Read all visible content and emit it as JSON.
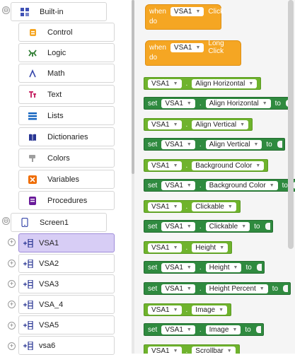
{
  "tree": {
    "builtin": {
      "label": "Built-in",
      "toggle": "⊖"
    },
    "categories": [
      {
        "label": "Control",
        "icon": "control-icon",
        "color": "#f5a623"
      },
      {
        "label": "Logic",
        "icon": "logic-icon",
        "color": "#2e7d32"
      },
      {
        "label": "Math",
        "icon": "math-icon",
        "color": "#3949ab"
      },
      {
        "label": "Text",
        "icon": "text-icon",
        "color": "#c2185b"
      },
      {
        "label": "Lists",
        "icon": "lists-icon",
        "color": "#1565c0"
      },
      {
        "label": "Dictionaries",
        "icon": "dictionaries-icon",
        "color": "#283593"
      },
      {
        "label": "Colors",
        "icon": "colors-icon",
        "color": "#9e9e9e"
      },
      {
        "label": "Variables",
        "icon": "variables-icon",
        "color": "#ef6c00"
      },
      {
        "label": "Procedures",
        "icon": "procedures-icon",
        "color": "#6a1b9a"
      }
    ],
    "screen": {
      "label": "Screen1",
      "toggle": "⊖"
    },
    "components": [
      {
        "label": "VSA1",
        "selected": true
      },
      {
        "label": "VSA2",
        "selected": false
      },
      {
        "label": "VSA3",
        "selected": false
      },
      {
        "label": "VSA_4",
        "selected": false
      },
      {
        "label": "VSA5",
        "selected": false
      },
      {
        "label": "vsa6",
        "selected": false
      }
    ]
  },
  "blocks": {
    "event_click": {
      "when": "when",
      "component": "VSA1",
      "event": "Click",
      "do": "do"
    },
    "event_longclick": {
      "when": "when",
      "component": "VSA1",
      "event": "Long Click",
      "do": "do"
    },
    "list": [
      {
        "type": "getter",
        "component": "VSA1",
        "property": "Align Horizontal"
      },
      {
        "type": "setter",
        "set": "set",
        "component": "VSA1",
        "property": "Align Horizontal",
        "to": "to"
      },
      {
        "type": "getter",
        "component": "VSA1",
        "property": "Align Vertical"
      },
      {
        "type": "setter",
        "set": "set",
        "component": "VSA1",
        "property": "Align Vertical",
        "to": "to"
      },
      {
        "type": "getter",
        "component": "VSA1",
        "property": "Background Color"
      },
      {
        "type": "setter",
        "set": "set",
        "component": "VSA1",
        "property": "Background Color",
        "to": "to"
      },
      {
        "type": "getter",
        "component": "VSA1",
        "property": "Clickable"
      },
      {
        "type": "setter",
        "set": "set",
        "component": "VSA1",
        "property": "Clickable",
        "to": "to"
      },
      {
        "type": "getter",
        "component": "VSA1",
        "property": "Height"
      },
      {
        "type": "setter",
        "set": "set",
        "component": "VSA1",
        "property": "Height",
        "to": "to"
      },
      {
        "type": "setter",
        "set": "set",
        "component": "VSA1",
        "property": "Height Percent",
        "to": "to"
      },
      {
        "type": "getter",
        "component": "VSA1",
        "property": "Image"
      },
      {
        "type": "setter",
        "set": "set",
        "component": "VSA1",
        "property": "Image",
        "to": "to"
      },
      {
        "type": "getter",
        "component": "VSA1",
        "property": "Scrollbar"
      }
    ],
    "dot": "."
  },
  "colors": {
    "event": "#f5a623",
    "getter": "#6fb32d",
    "setter": "#2f8a3f",
    "selected": "#d7cdf5"
  }
}
